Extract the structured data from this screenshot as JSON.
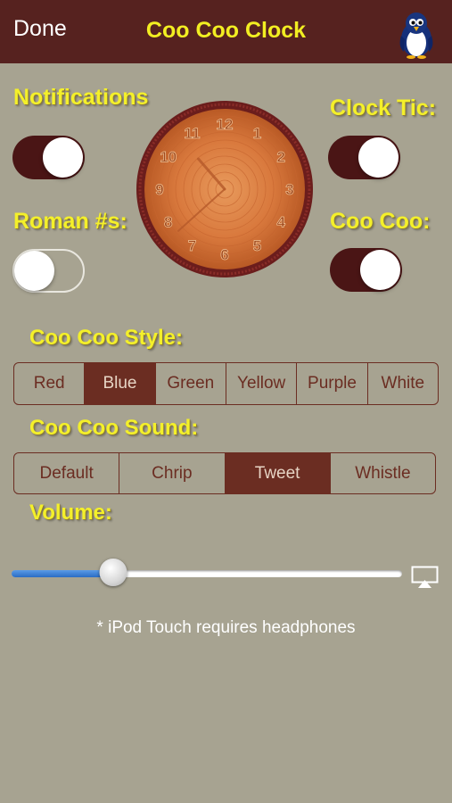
{
  "nav": {
    "done_label": "Done",
    "title": "Coo Coo Clock",
    "bird_icon": "bird-icon"
  },
  "labels": {
    "notifications": "Notifications",
    "clock_tic": "Clock Tic:",
    "roman": "Roman #s:",
    "coo_coo": "Coo Coo:",
    "style": "Coo Coo Style:",
    "sound": "Coo Coo Sound:",
    "volume": "Volume:"
  },
  "switches": {
    "notifications": true,
    "clock_tic": true,
    "roman": false,
    "coo_coo": true
  },
  "clock": {
    "numerals": [
      "12",
      "1",
      "2",
      "3",
      "4",
      "5",
      "6",
      "7",
      "8",
      "9",
      "10",
      "11"
    ],
    "hour": 10,
    "minute": 38
  },
  "style_options": [
    "Red",
    "Blue",
    "Green",
    "Yellow",
    "Purple",
    "White"
  ],
  "style_selected": "Blue",
  "sound_options": [
    "Default",
    "Chrip",
    "Tweet",
    "Whistle"
  ],
  "sound_selected": "Tweet",
  "volume": 0.26,
  "footnote": "* iPod Touch requires headphones",
  "colors": {
    "navbar": "#56221f",
    "accent": "#f4f02a",
    "selected": "#6b2d22",
    "background": "#a7a391"
  }
}
